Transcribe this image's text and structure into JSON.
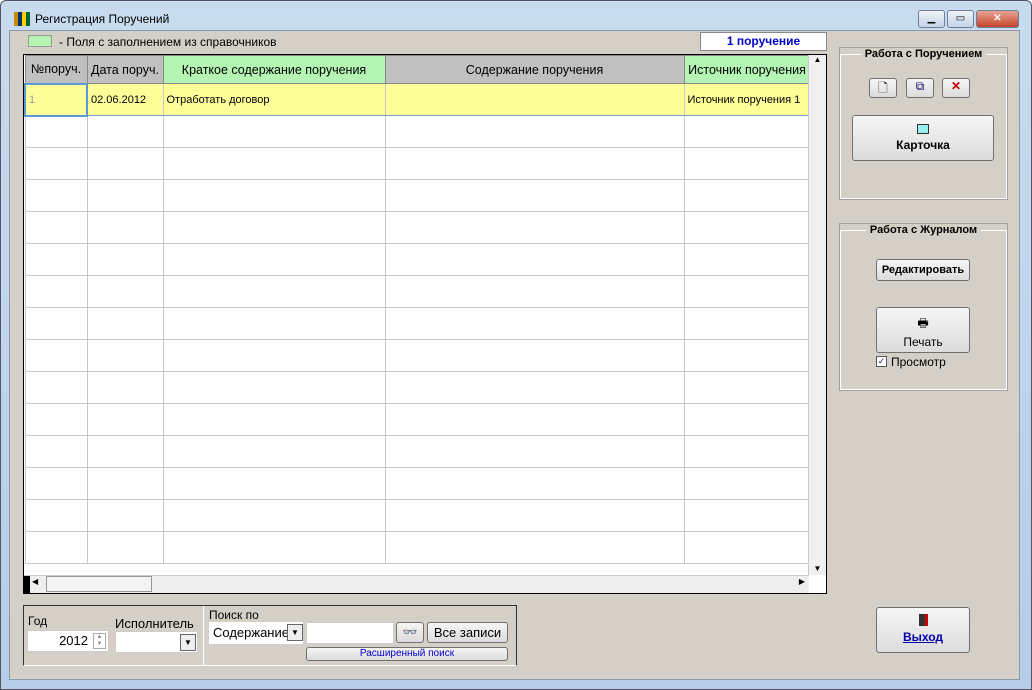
{
  "window": {
    "title": "Регистрация Поручений"
  },
  "legend_text": "- Поля с заполнением из справочников",
  "count_badge": "1 поручение",
  "table": {
    "columns": [
      "№поруч.",
      "Дата поруч.",
      "Краткое содержание поручения",
      "Содержание поручения",
      "Источник поручения"
    ],
    "rows": [
      [
        "1",
        "02.06.2012",
        "Отработать договор",
        "",
        "Источник поручения 1"
      ]
    ]
  },
  "right": {
    "group1_title": "Работа с Поручением",
    "card_label": "Карточка",
    "group2_title": "Работа с Журналом",
    "edit_label": "Редактировать",
    "print_label": "Печать",
    "preview_label": "Просмотр",
    "preview_checked": true,
    "exit_label": "Выход"
  },
  "bottom": {
    "year_label": "Год",
    "year_value": "2012",
    "executor_label": "Исполнитель",
    "executor_value": "",
    "search_by_label": "Поиск по",
    "search_field_value": "Содержание",
    "search_input_value": "",
    "all_records_label": "Все записи",
    "advanced_search_label": "Расширенный поиск"
  },
  "colors": {
    "highlight": "#b4f5b4",
    "selected_row": "#ffff99",
    "badge_text": "#0000cc"
  }
}
